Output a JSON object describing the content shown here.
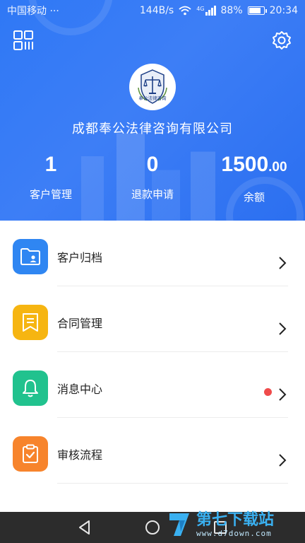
{
  "status_bar": {
    "carrier": "中国移动 ···",
    "network_speed": "144B/s",
    "network_type": "4G",
    "battery_percent": 88,
    "battery_label": "88%",
    "time": "20:34"
  },
  "header": {
    "scan_icon": "qr-scan-icon",
    "settings_icon": "gear-icon",
    "logo_text": "奉公法律咨询",
    "company_name": "成都奉公法律咨询有限公司",
    "accent_color": "#3079f5"
  },
  "stats": [
    {
      "value": "1",
      "label": "客户管理"
    },
    {
      "value": "0",
      "label": "退款申请"
    },
    {
      "value_int": "1500",
      "value_dec": ".00",
      "label": "余额"
    }
  ],
  "menu": [
    {
      "label": "客户归档",
      "icon": "folder-user-icon",
      "color": "#2f86f2",
      "badge": false
    },
    {
      "label": "合同管理",
      "icon": "contract-bookmark-icon",
      "color": "#f6b511",
      "badge": false
    },
    {
      "label": "消息中心",
      "icon": "bell-icon",
      "color": "#21c28e",
      "badge": true
    },
    {
      "label": "审核流程",
      "icon": "clipboard-check-icon",
      "color": "#f7842c",
      "badge": false
    }
  ],
  "watermark": {
    "title": "第七下载站",
    "url": "www.d7down.com"
  }
}
